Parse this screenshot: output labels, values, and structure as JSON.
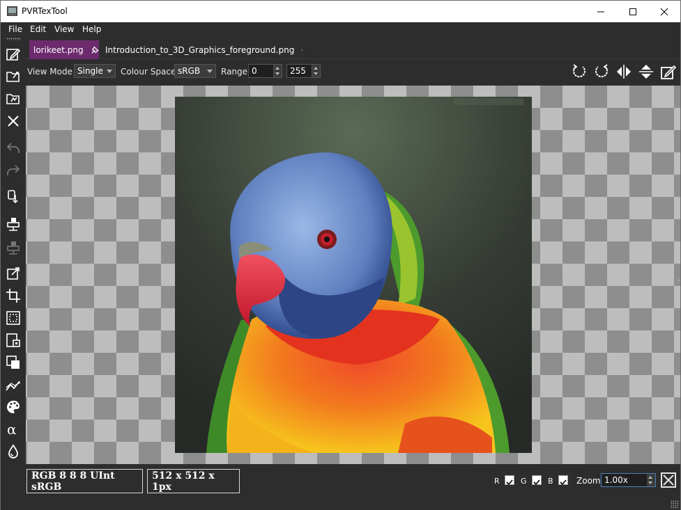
{
  "window": {
    "title": "PVRTexTool"
  },
  "menu": [
    {
      "label": "File"
    },
    {
      "label": "Edit"
    },
    {
      "label": "View"
    },
    {
      "label": "Help"
    }
  ],
  "tabs": [
    {
      "label": "lorikeet.png",
      "active": true
    },
    {
      "label": "Introduction_to_3D_Graphics_foreground.png",
      "active": false
    }
  ],
  "options": {
    "view_mode_label": "View Mode",
    "view_mode_value": "Single",
    "colour_space_label": "Colour Space",
    "colour_space_value": "sRGB",
    "range_label": "Range",
    "range_min": "0",
    "range_max": "255"
  },
  "toolbar_icons": [
    "edit-icon",
    "open-icon",
    "open-recent-icon",
    "close-icon",
    "undo-icon",
    "redo-icon",
    "encode-icon",
    "decode-icon",
    "compare-icon",
    "resize-icon",
    "crop-icon",
    "border-icon",
    "mipmap-icon",
    "layers-icon",
    "graph-icon",
    "palette-icon",
    "alpha-icon",
    "bleed-icon"
  ],
  "right_icons": [
    "rotate-ccw-icon",
    "rotate-cw-icon",
    "flip-horizontal-icon",
    "flip-vertical-icon",
    "edit-metadata-icon"
  ],
  "status": {
    "format": "RGB 8 8 8 UInt sRGB",
    "dimensions": "512 x 512 x 1px",
    "channels": [
      {
        "label": "R",
        "checked": true
      },
      {
        "label": "G",
        "checked": true
      },
      {
        "label": "B",
        "checked": true
      }
    ],
    "zoom_label": "Zoom",
    "zoom_value": "1.00x"
  },
  "colors": {
    "active_tab": "#6d2b6e",
    "background": "#2d2d2d",
    "checker_dark": "#8e8e8e",
    "checker_light": "#bdbdbd"
  }
}
